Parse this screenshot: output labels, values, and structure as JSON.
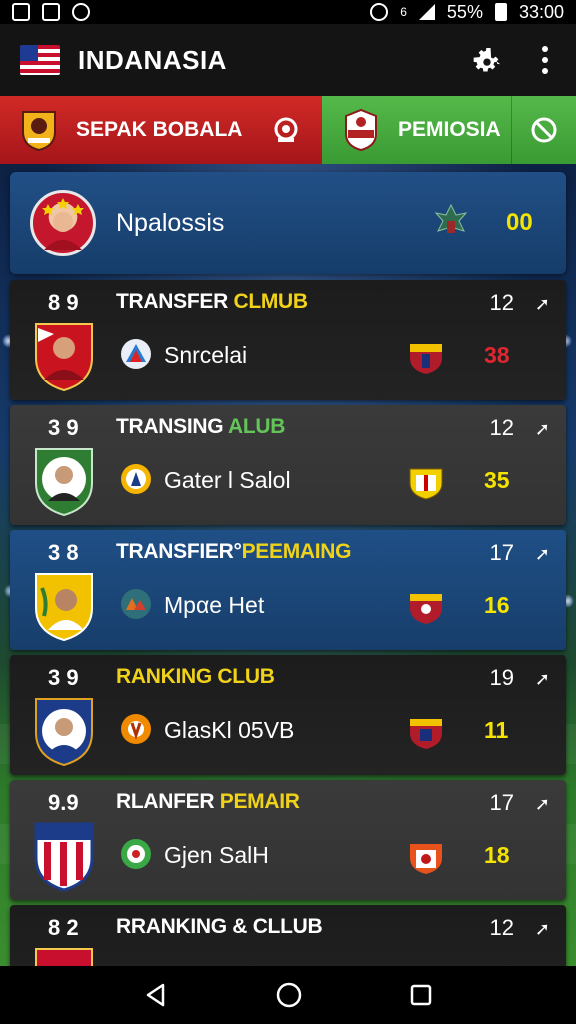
{
  "status_bar": {
    "battery": "55%",
    "time": "33:00",
    "signal_label": "6"
  },
  "app": {
    "title": "INDANASIA",
    "flag_icon": "us-flag-icon",
    "settings_icon": "gear-icon",
    "menu_icon": "kebab-menu-icon"
  },
  "tabs": [
    {
      "label": "SEPAK BOBALA",
      "color": "#c41f22",
      "action_icon": "target-icon"
    },
    {
      "label": "PEMIOSIA",
      "color": "#4bb040",
      "action_icon": "blocked-icon"
    }
  ],
  "hero": {
    "name": "Npalossis",
    "score": "00"
  },
  "clubs": [
    {
      "rank": "8 9",
      "title_plain": "TRANSFER ",
      "title_highlight": "CLMUB",
      "highlight_color": "yellow",
      "count": "12",
      "player": "Snrcelai",
      "points": "38",
      "points_color": "red",
      "style": "dark"
    },
    {
      "rank": "3 9",
      "title_plain": "TRANSING ",
      "title_highlight": "ALUB",
      "highlight_color": "green",
      "count": "12",
      "player": "Gater l Salol",
      "points": "35",
      "points_color": "yellow",
      "style": "grey"
    },
    {
      "rank": "3 8",
      "title_plain": "TRANSFIER°",
      "title_highlight": "PEEMAING",
      "highlight_color": "yellow",
      "count": "17",
      "player": "Mpαe Het",
      "points": "16",
      "points_color": "yellow",
      "style": "blue"
    },
    {
      "rank": "3 9",
      "title_plain": "",
      "title_highlight": "RANKING CLUB",
      "highlight_color": "yellow",
      "count": "19",
      "player": "GlasKl 05VB",
      "points": "11",
      "points_color": "yellow",
      "style": "dark"
    },
    {
      "rank": "9.9",
      "title_plain": "RLANFER ",
      "title_highlight": "PEMAIR",
      "highlight_color": "yellow",
      "count": "17",
      "player": "Gjen SalH",
      "points": "18",
      "points_color": "yellow",
      "style": "grey"
    },
    {
      "rank": "8 2",
      "title_plain": "RRANKING & CLLUB",
      "title_highlight": "",
      "highlight_color": "yellow",
      "count": "12",
      "player": "",
      "points": "",
      "points_color": "yellow",
      "style": "dark"
    }
  ],
  "nav": {
    "back_icon": "back-triangle-icon",
    "home_icon": "home-circle-icon",
    "recents_icon": "recents-square-icon"
  }
}
